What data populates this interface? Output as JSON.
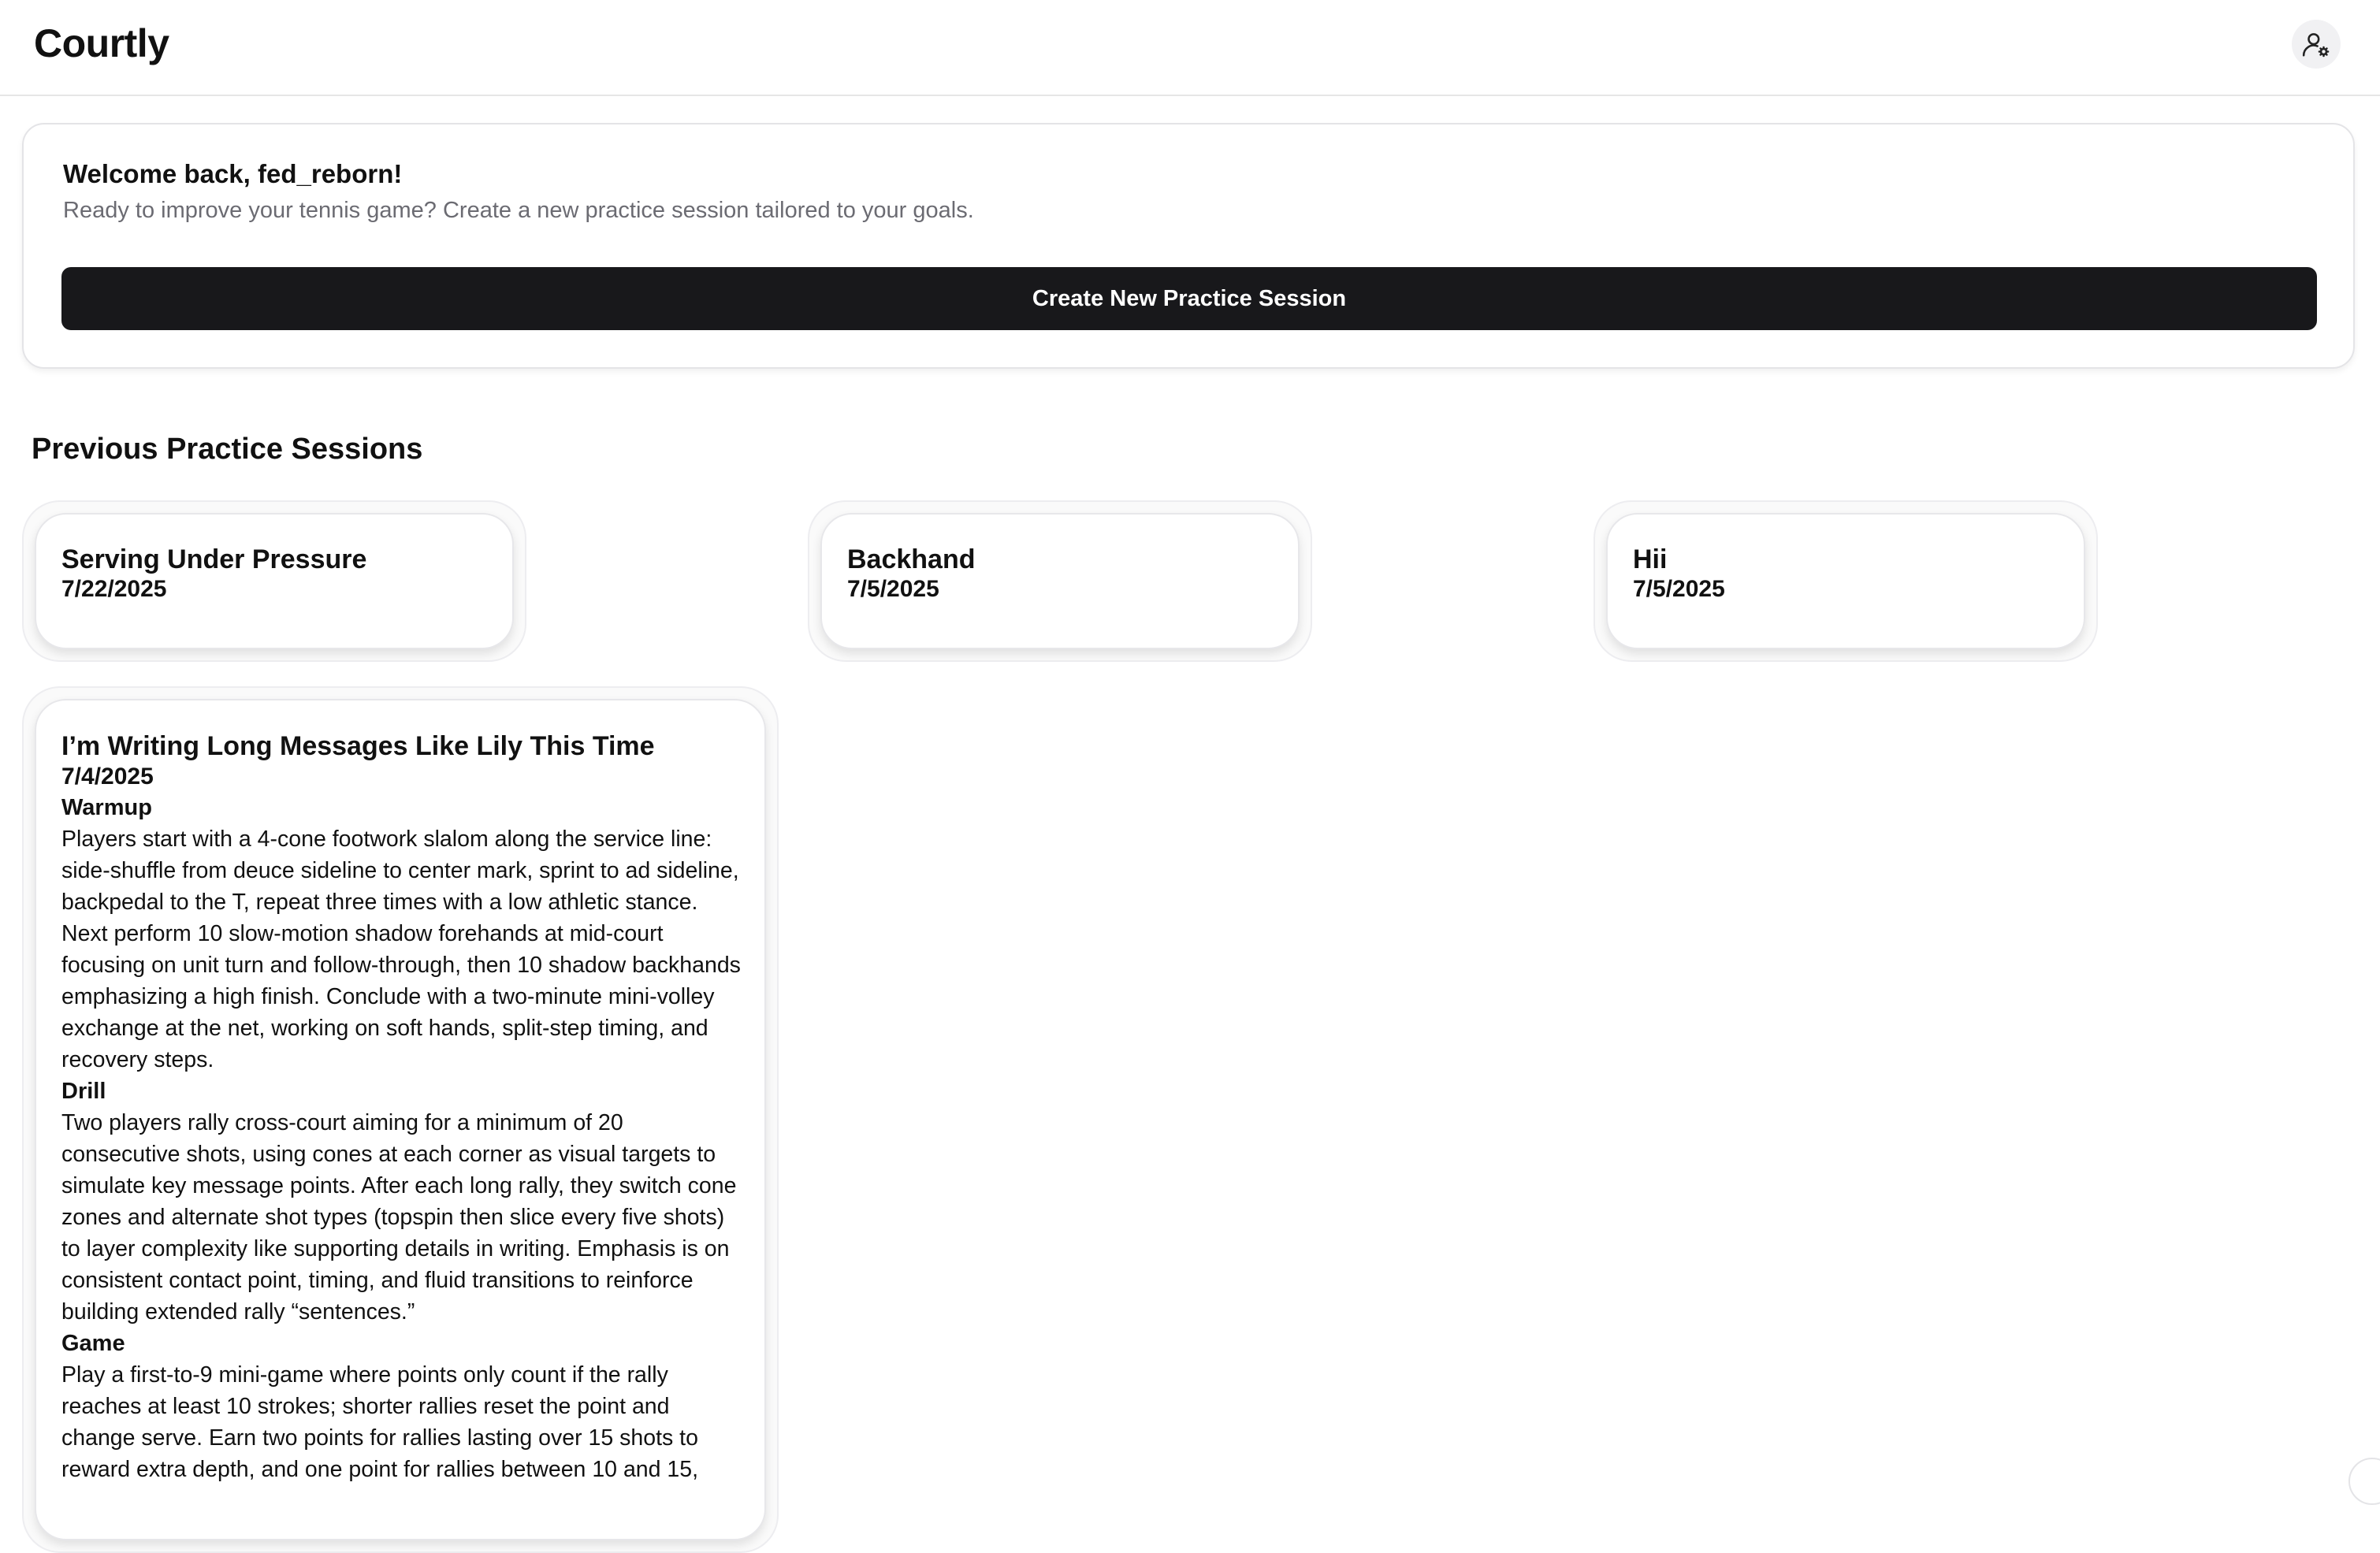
{
  "app": {
    "title": "Courtly"
  },
  "header": {
    "profile_icon": "user-settings-icon"
  },
  "welcome": {
    "title": "Welcome back, fed_reborn!",
    "subtitle": "Ready to improve your tennis game? Create a new practice session tailored to your goals.",
    "create_label": "Create New Practice Session"
  },
  "sessions": {
    "heading": "Previous Practice Sessions",
    "items": [
      {
        "title": "Serving Under Pressure",
        "date": "7/22/2025"
      },
      {
        "title": "Backhand",
        "date": "7/5/2025"
      },
      {
        "title": "Hii",
        "date": "7/5/2025"
      },
      {
        "title": "I’m Writing Long Messages Like Lily This Time",
        "date": "7/4/2025",
        "warmup_heading": "Warmup",
        "warmup_text": "Players start with a 4-cone footwork slalom along the service line: side-shuffle from deuce sideline to center mark, sprint to ad sideline, backpedal to the T, repeat three times with a low athletic stance. Next perform 10 slow-motion shadow forehands at mid-court focusing on unit turn and follow-through, then 10 shadow backhands emphasizing a high finish. Conclude with a two-minute mini-volley exchange at the net, working on soft hands, split-step timing, and recovery steps.",
        "drill_heading": "Drill",
        "drill_text": "Two players rally cross-court aiming for a minimum of 20 consecutive shots, using cones at each corner as visual targets to simulate key message points. After each long rally, they switch cone zones and alternate shot types (topspin then slice every five shots) to layer complexity like supporting details in writing. Emphasis is on consistent contact point, timing, and fluid transitions to reinforce building extended rally “sentences.”",
        "game_heading": "Game",
        "game_text": "Play a first-to-9 mini-game where points only count if the rally reaches at least 10 strokes; shorter rallies reset the point and change serve. Earn two points for rallies lasting over 15 shots to reward extra depth, and one point for rallies between 10 and 15,"
      }
    ]
  }
}
